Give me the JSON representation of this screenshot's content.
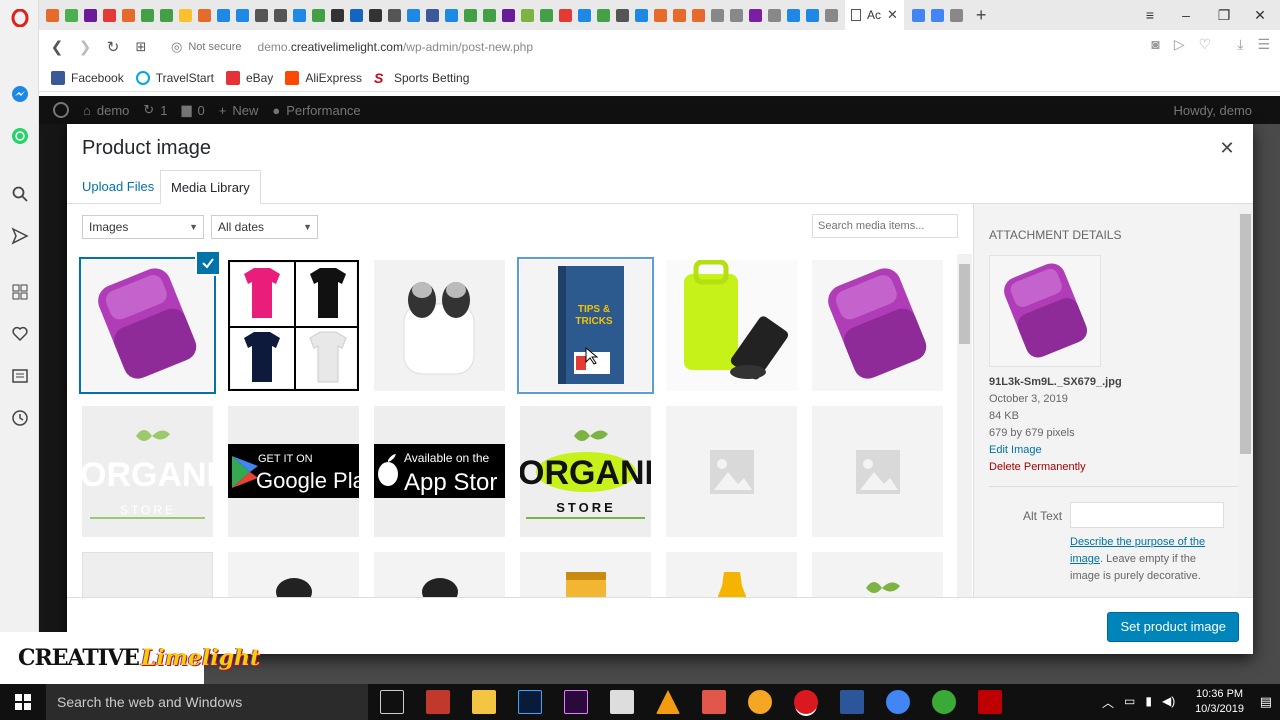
{
  "browser": {
    "active_tab_title": "Ac",
    "security_label": "Not secure",
    "url_host_prefix": "demo.",
    "url_domain": "creativelimelight.com",
    "url_path": "/wp-admin/post-new.php",
    "bookmarks": [
      {
        "label": "Facebook",
        "color": "#3b5998"
      },
      {
        "label": "TravelStart",
        "color": "#00a8e1"
      },
      {
        "label": "eBay",
        "color": "#e53238"
      },
      {
        "label": "AliExpress",
        "color": "#ff4700"
      },
      {
        "label": "Sports Betting",
        "color": "#d0021b"
      }
    ]
  },
  "wp_admin_bar": {
    "site": "demo",
    "updates": "1",
    "comments": "0",
    "new": "New",
    "performance": "Performance",
    "howdy": "Howdy, demo"
  },
  "modal": {
    "title": "Product image",
    "tabs": {
      "upload": "Upload Files",
      "library": "Media Library"
    },
    "filter_type": "Images",
    "filter_date": "All dates",
    "search_placeholder": "Search media items...",
    "thumbnails": [
      {
        "label": "purple wallet case",
        "state": "selected"
      },
      {
        "label": "polo shirts grid",
        "state": "normal"
      },
      {
        "label": "wireless earbuds case",
        "state": "normal"
      },
      {
        "label": "tips and tricks book",
        "state": "hover"
      },
      {
        "label": "neon phone pouch",
        "state": "normal"
      },
      {
        "label": "purple wallet case",
        "state": "normal"
      },
      {
        "label": "organic store logo faded",
        "state": "normal"
      },
      {
        "label": "google play badge",
        "state": "normal"
      },
      {
        "label": "app store badge",
        "state": "normal"
      },
      {
        "label": "organic store logo",
        "state": "normal"
      },
      {
        "label": "image placeholder",
        "state": "normal"
      },
      {
        "label": "image placeholder",
        "state": "normal"
      }
    ],
    "badge_texts": {
      "google_top": "GET IT ON",
      "google_bottom": "Google Pla",
      "apple_top": "Available on the",
      "apple_bottom": "App Stor",
      "organic_big": "ORGANI",
      "organic_small": "STORE",
      "book_title_1": "TIPS &",
      "book_title_2": "TRICKS"
    },
    "details": {
      "heading": "Attachment Details",
      "filename": "91L3k-Sm9L._SX679_.jpg",
      "date": "October 3, 2019",
      "size": "84 KB",
      "dimensions": "679 by 679 pixels",
      "edit_link": "Edit Image",
      "delete_link": "Delete Permanently",
      "alt_label": "Alt Text",
      "alt_desc_link": "Describe the purpose of the image",
      "alt_desc_rest": ". Leave empty if the image is purely decorative."
    },
    "primary_button": "Set product image"
  },
  "overlay_logo": {
    "word1": "CREATIVE",
    "word2": "Limelight"
  },
  "taskbar": {
    "search_placeholder": "Search the web and Windows",
    "time": "10:36 PM",
    "date": "10/3/2019"
  },
  "colors": {
    "wp_blue": "#0073aa",
    "button_blue": "#0085ba",
    "delete_red": "#a00",
    "product_purple": "#b03cb8",
    "neon_green": "#c6f21a"
  }
}
